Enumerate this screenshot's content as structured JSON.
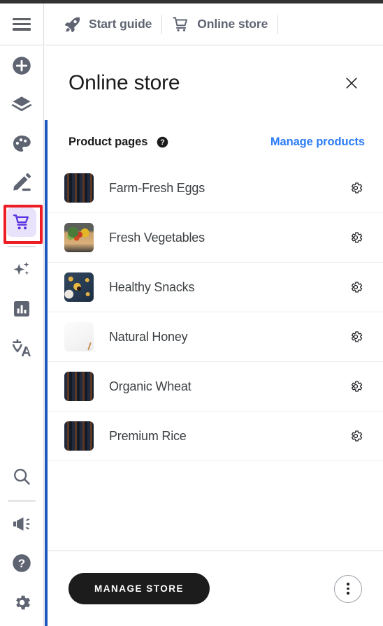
{
  "topbar": {
    "menu_icon": "hamburger-menu-icon",
    "items": [
      {
        "label": "Start guide",
        "icon": "rocket-icon"
      },
      {
        "label": "Online store",
        "icon": "shopping-cart-icon"
      }
    ]
  },
  "sidebar": {
    "top_items": [
      {
        "name": "add",
        "icon": "plus-circle-icon",
        "selected": false
      },
      {
        "name": "pages",
        "icon": "layers-icon",
        "selected": false
      },
      {
        "name": "design",
        "icon": "palette-icon",
        "selected": false
      },
      {
        "name": "edit",
        "icon": "pencil-icon",
        "selected": false
      },
      {
        "name": "store",
        "icon": "shopping-cart-icon",
        "selected": true
      }
    ],
    "mid_items": [
      {
        "name": "ai-assistant",
        "icon": "sparkles-icon",
        "selected": false
      },
      {
        "name": "analytics",
        "icon": "bar-chart-icon",
        "selected": false
      },
      {
        "name": "translate",
        "icon": "translate-icon",
        "selected": false
      }
    ],
    "bottom_items": [
      {
        "name": "search",
        "icon": "magnifier-icon",
        "selected": false
      },
      {
        "name": "announcements",
        "icon": "megaphone-icon",
        "selected": false
      },
      {
        "name": "help",
        "icon": "question-circle-icon",
        "selected": false
      },
      {
        "name": "settings",
        "icon": "gear-icon",
        "selected": false
      }
    ],
    "selected_highlight_color": "#ee1c25",
    "selected_tile_color": "#e8e2fb",
    "icon_color": "#5f6472",
    "accent_color": "#5c33e1"
  },
  "panel": {
    "title": "Online store",
    "close_icon": "close-x-icon",
    "accent_color": "#1a56bd",
    "section": {
      "title": "Product pages",
      "help_icon": "question-circle-icon",
      "action_label": "Manage products",
      "action_color": "#2b7cf6"
    },
    "products": [
      {
        "name": "Farm-Fresh Eggs",
        "thumb": "market-shelves-photo",
        "gear_icon": "gear-icon"
      },
      {
        "name": "Fresh Vegetables",
        "thumb": "vegetable-basket-photo",
        "gear_icon": "gear-icon"
      },
      {
        "name": "Healthy Snacks",
        "thumb": "snack-bowl-photo",
        "gear_icon": "gear-icon"
      },
      {
        "name": "Natural Honey",
        "thumb": "blank-white-photo",
        "gear_icon": "gear-icon"
      },
      {
        "name": "Organic Wheat",
        "thumb": "market-shelves-photo",
        "gear_icon": "gear-icon"
      },
      {
        "name": "Premium Rice",
        "thumb": "market-shelves-photo",
        "gear_icon": "gear-icon"
      }
    ],
    "footer": {
      "manage_store_label": "MANAGE STORE",
      "more_icon": "more-vertical-icon"
    }
  }
}
